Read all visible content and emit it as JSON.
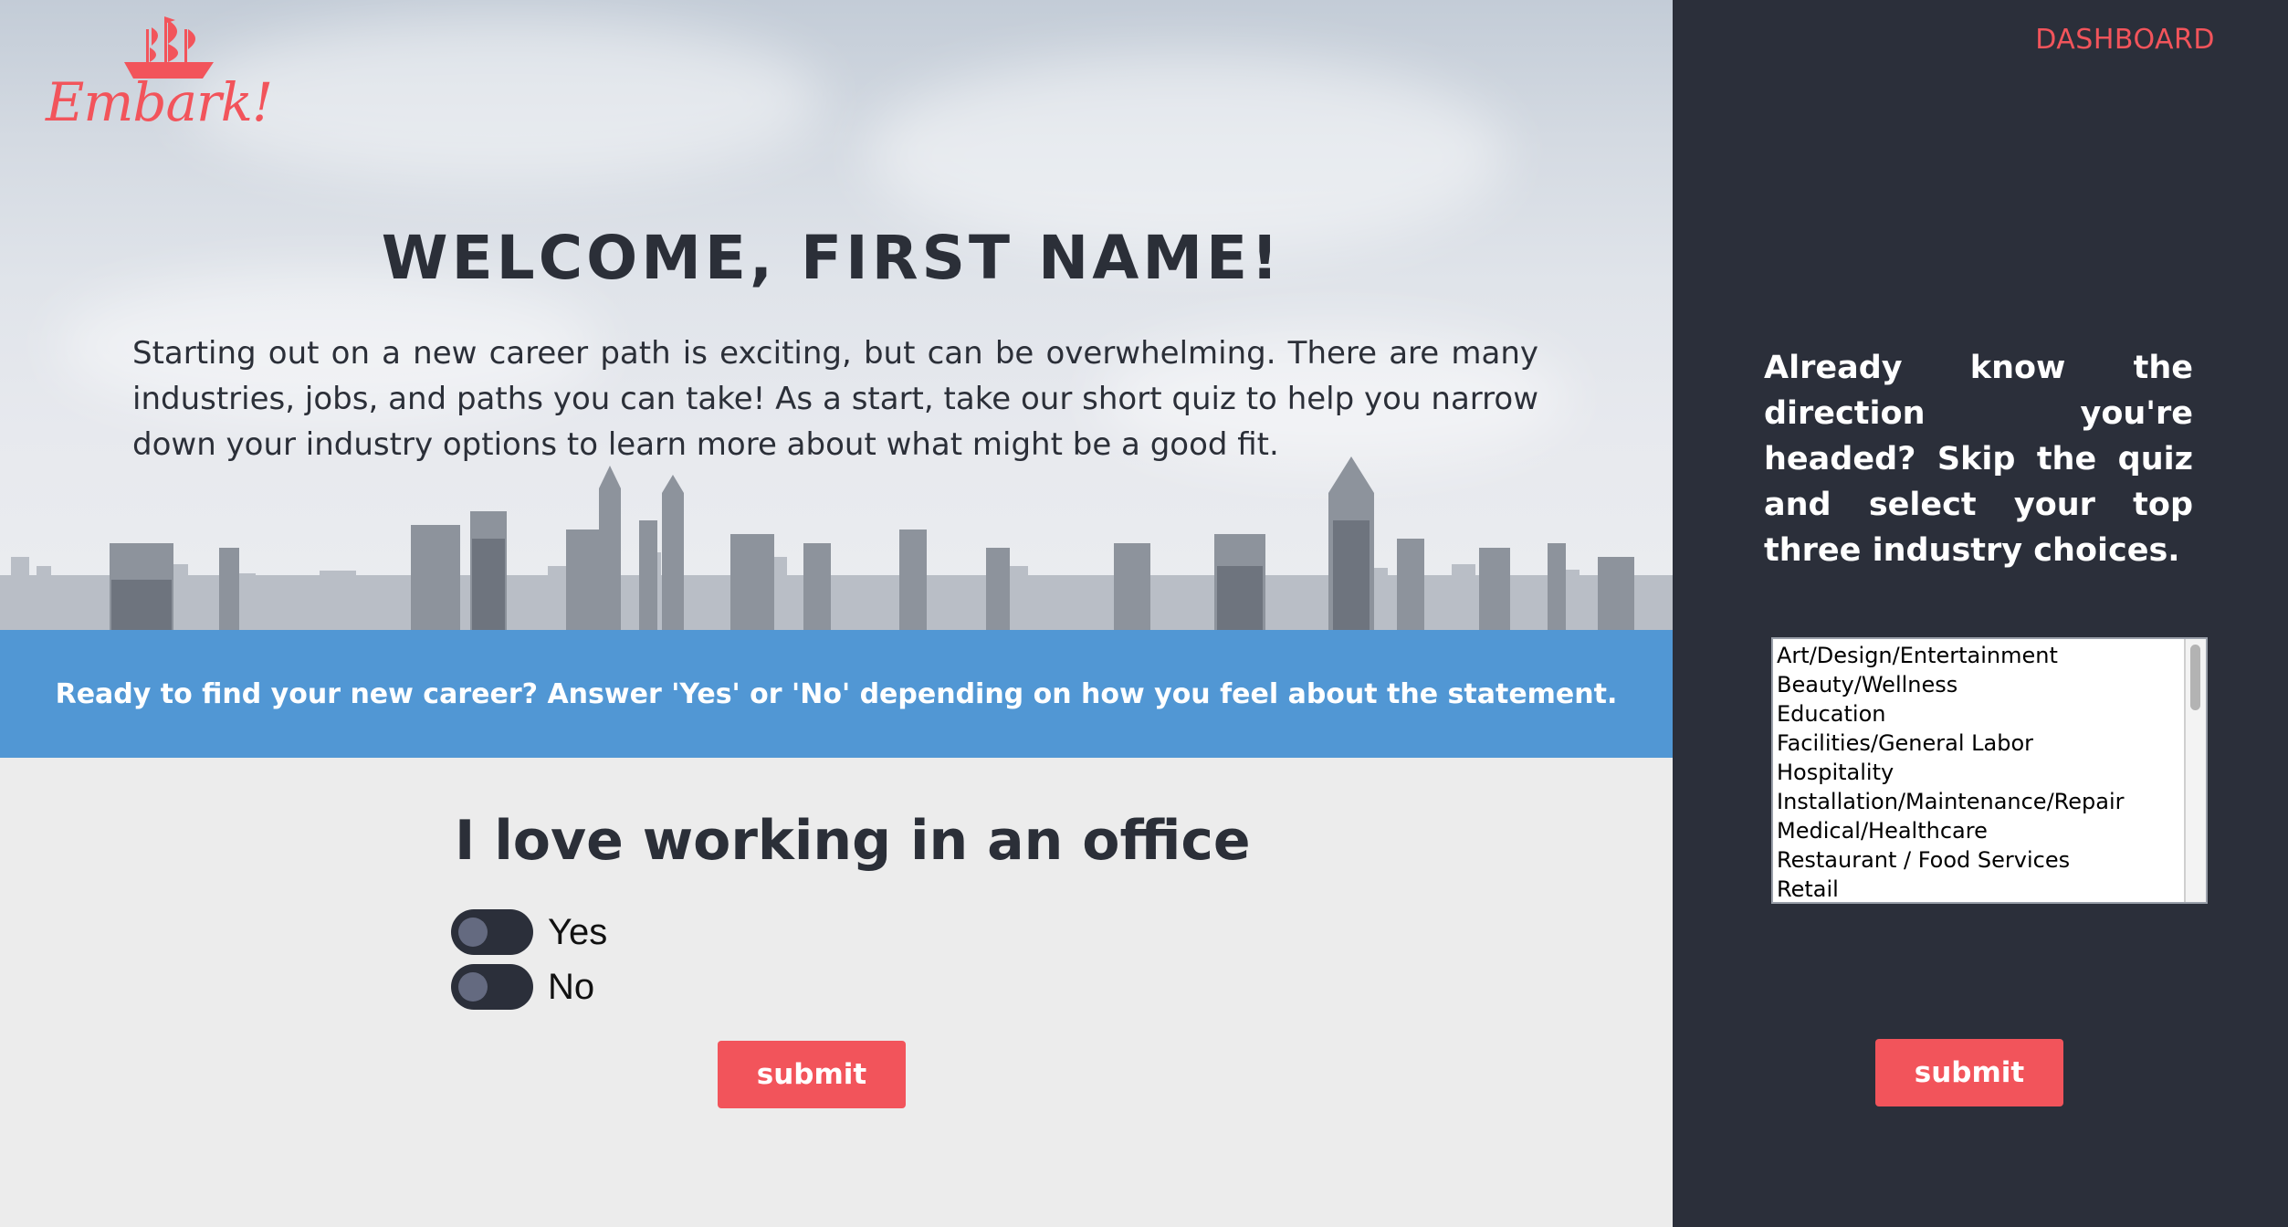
{
  "brand": {
    "logo_text": "Embark!"
  },
  "hero": {
    "welcome": "WELCOME, FIRST NAME!",
    "intro": "Starting out on a new career path is exciting, but can be overwhelming. There are many industries, jobs, and paths you can take! As a start, take our short quiz to help you narrow down your industry options to learn more about what might be a good fit."
  },
  "banner": {
    "text": "Ready to find your new career? Answer 'Yes' or 'No' depending on how you feel about the statement."
  },
  "quiz": {
    "question": "I love working in an office",
    "options": [
      {
        "label": "Yes",
        "checked": false
      },
      {
        "label": "No",
        "checked": false
      }
    ],
    "submit_label": "submit"
  },
  "sidebar": {
    "dashboard_label": "DASHBOARD",
    "skip_text": "Already know the direction you're headed? Skip the quiz and select your top three industry choices.",
    "industries": [
      "Art/Design/Entertainment",
      "Beauty/Wellness",
      "Education",
      "Facilities/General Labor",
      "Hospitality",
      "Installation/Maintenance/Repair",
      "Medical/Healthcare",
      "Restaurant / Food Services",
      "Retail"
    ],
    "submit_label": "submit"
  },
  "colors": {
    "accent": "#f2545b",
    "banner": "#5197d4",
    "sidebar": "#2b2f3a",
    "page": "#ececec",
    "text_dark": "#2b2f38"
  }
}
